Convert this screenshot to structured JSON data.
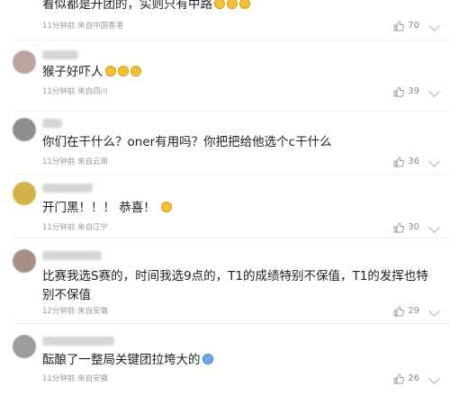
{
  "comments": [
    {
      "text": "看似都是开团的，实则只有中路",
      "time": "11分钟前",
      "location": "来自中国香港",
      "likes": "70",
      "emoji": [
        "face",
        "face",
        "face"
      ]
    },
    {
      "text": "猴子好吓人",
      "time": "11分钟前",
      "location": "来自四川",
      "likes": "39",
      "emoji": [
        "face",
        "face",
        "face"
      ]
    },
    {
      "text": "你们在干什么？oner有用吗？你把把给他选个c干什么",
      "time": "11分钟前",
      "location": "来自云南",
      "likes": "36",
      "emoji": []
    },
    {
      "text": "开门黑！！！ 恭喜！",
      "time": "11分钟前",
      "location": "来自辽宁",
      "likes": "30",
      "emoji": [
        "face"
      ]
    },
    {
      "text": "比赛我选S赛的，时间我选9点的，T1的成绩特别不保值，T1的发挥也特别不保值",
      "time": "12分钟前",
      "location": "来自安徽",
      "likes": "29",
      "emoji": []
    },
    {
      "text": "酝酿了一整局关键团拉垮大的",
      "time": "11分钟前",
      "location": "来自安徽",
      "likes": "26",
      "emoji": [
        "mixed"
      ]
    }
  ]
}
